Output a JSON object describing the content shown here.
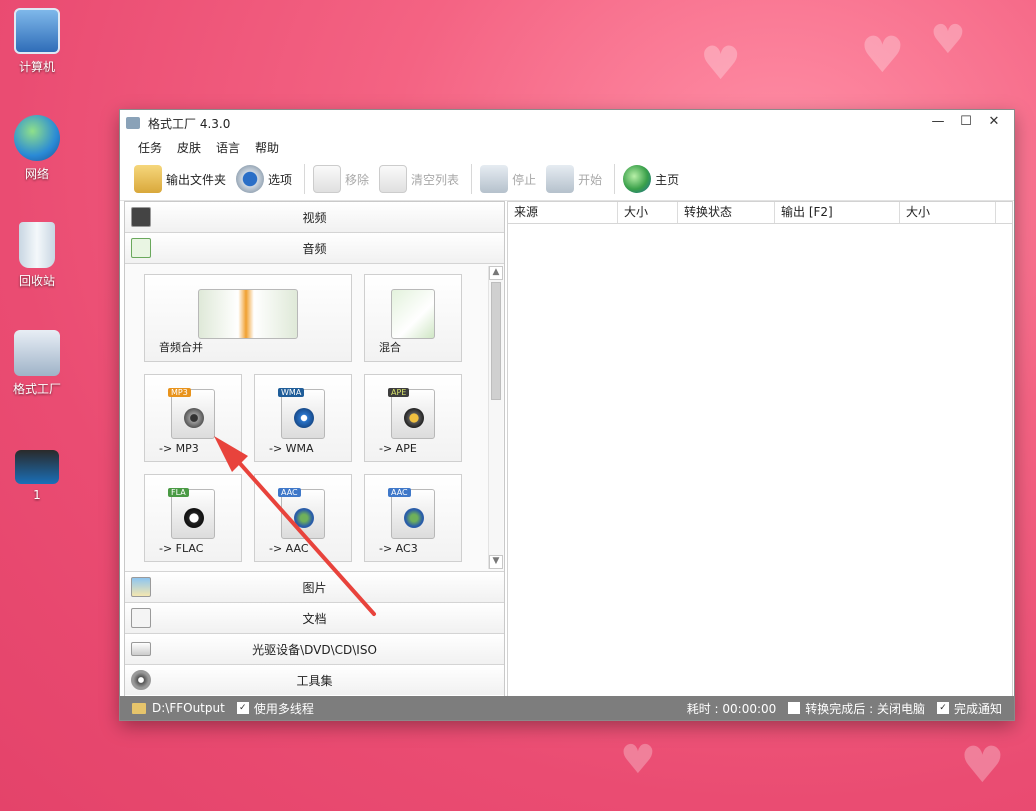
{
  "desktop": {
    "icons": [
      {
        "label": "计算机",
        "icon": "computer-icon"
      },
      {
        "label": "网络",
        "icon": "network-icon"
      },
      {
        "label": "回收站",
        "icon": "recycle-bin-icon"
      },
      {
        "label": "格式工厂",
        "icon": "format-factory-icon"
      },
      {
        "label": "1",
        "icon": "video-file-icon"
      }
    ]
  },
  "window": {
    "title": "格式工厂 4.3.0",
    "controls": {
      "minimize": "—",
      "maximize": "☐",
      "close": "✕"
    }
  },
  "menu": [
    "任务",
    "皮肤",
    "语言",
    "帮助"
  ],
  "toolbar": {
    "output_folder": "输出文件夹",
    "options": "选项",
    "remove": "移除",
    "clear_list": "清空列表",
    "stop": "停止",
    "start": "开始",
    "home": "主页"
  },
  "categories": {
    "video": "视频",
    "audio": "音频",
    "picture": "图片",
    "document": "文档",
    "optical": "光驱设备\\DVD\\CD\\ISO",
    "tools": "工具集"
  },
  "audio_tiles": [
    {
      "label": "音频合并",
      "badge": ""
    },
    {
      "label": "混合",
      "badge": ""
    },
    {
      "label": "-> MP3",
      "badge": "MP3"
    },
    {
      "label": "-> WMA",
      "badge": "WMA"
    },
    {
      "label": "-> APE",
      "badge": "APE"
    },
    {
      "label": "-> FLAC",
      "badge": "FLA"
    },
    {
      "label": "-> AAC",
      "badge": "AAC"
    },
    {
      "label": "-> AC3",
      "badge": "AAC"
    }
  ],
  "table": {
    "columns": [
      "来源",
      "大小",
      "转换状态",
      "输出 [F2]",
      "大小"
    ]
  },
  "status": {
    "output_path": "D:\\FFOutput",
    "multithread": "使用多线程",
    "elapsed": "耗时 : 00:00:00",
    "after_done": "转换完成后 : 关闭电脑",
    "notify": "完成通知"
  },
  "colors": {
    "accent_arrow": "#e8433c",
    "statusbar": "#7d7d7d"
  }
}
